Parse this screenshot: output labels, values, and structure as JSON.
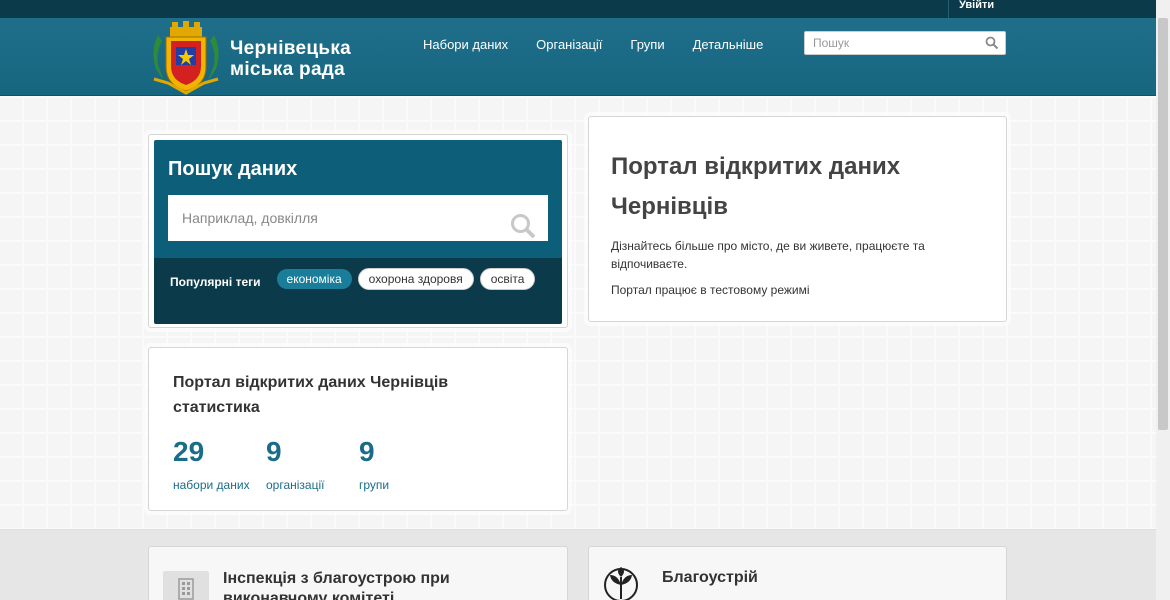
{
  "account": {
    "login_label": "Увійти"
  },
  "header": {
    "title_line1": "Чернівецька",
    "title_line2": "міська рада",
    "nav": [
      {
        "label": "Набори даних"
      },
      {
        "label": "Організації"
      },
      {
        "label": "Групи"
      },
      {
        "label": "Детальніше"
      }
    ],
    "search": {
      "placeholder": "Пошук",
      "icon": "search-icon"
    }
  },
  "search_panel": {
    "title": "Пошук даних",
    "placeholder": "Наприклад, довкілля",
    "popular_tags_label": "Популярні теги",
    "tags": [
      "економіка",
      "охорона здоровя",
      "освіта"
    ]
  },
  "intro": {
    "title_line1": "Портал відкритих даних",
    "title_line2": "Чернівців",
    "description": "Дізнайтесь більше про місто, де ви живете, працюєте та відпочиваєте.",
    "notice": "Портал працює в тестовому режимі"
  },
  "stats": {
    "title_line1": "Портал відкритих даних Чернівців",
    "title_line2": "статистика",
    "items": [
      {
        "value": "29",
        "label": "набори даних"
      },
      {
        "value": "9",
        "label": "організації"
      },
      {
        "value": "9",
        "label": "групи"
      }
    ]
  },
  "featured": {
    "organization": {
      "title_line1": "Інспекція з благоустрою при",
      "title_line2": "виконавчому комітеті",
      "icon": "building-icon"
    },
    "group": {
      "title": "Благоустрій",
      "icon": "leaf-icon"
    }
  },
  "colors": {
    "header": "#166680",
    "masthead": "#0b3a4b",
    "search_panel": "#0d5e78",
    "accent": "#1a6d8a"
  }
}
